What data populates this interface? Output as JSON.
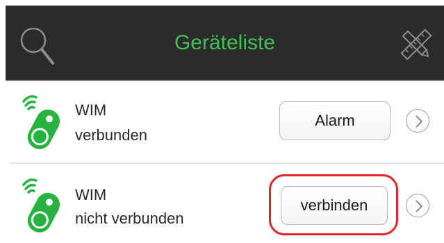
{
  "header": {
    "title": "Geräteliste",
    "left_icon": "search-icon",
    "right_icon": "tools-icon"
  },
  "devices": [
    {
      "name": "WIM",
      "status": "verbunden",
      "action_label": "Alarm",
      "icon": "bluetooth-tag-icon"
    },
    {
      "name": "WIM",
      "status": "nicht verbunden",
      "action_label": "verbinden",
      "icon": "bluetooth-tag-icon"
    }
  ],
  "colors": {
    "header_bg": "#2b2b2b",
    "title": "#3ec24f",
    "tag_green": "#27b341",
    "highlight": "#e0242b"
  }
}
